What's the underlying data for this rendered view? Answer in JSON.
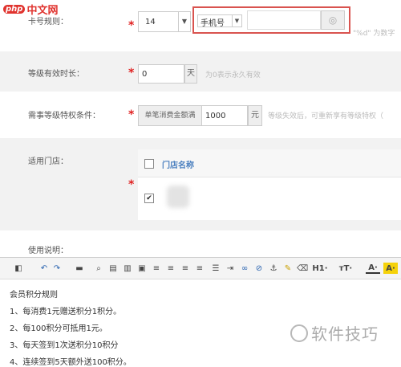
{
  "logo": {
    "text": "中文网",
    "badge": "php"
  },
  "rules": {
    "card_rule_label": "卡号规则：",
    "length_value": "14",
    "type_value": "手机号",
    "hint": "\"%d\" 为数字"
  },
  "validity": {
    "label": "等级有效时长：",
    "value": "0",
    "unit": "天",
    "hint": "为0表示永久有效"
  },
  "enjoy": {
    "label": "需事等级特权条件：",
    "prefix": "单笔消费金额满",
    "value": "1000",
    "unit": "元",
    "hint": "等级失效后，可重新享有等级特权（"
  },
  "stores": {
    "label": "适用门店：",
    "column_header": "门店名称"
  },
  "usage": {
    "label": "使用说明：",
    "toolbar": {
      "heading_btn": "H1·",
      "fontsize_btn": "тT·",
      "fontcolor_btn": "A·",
      "highlight_btn": "A·"
    },
    "content": [
      "会员积分规则",
      "1、每消费1元赠送积分1积分。",
      "2、每100积分可抵用1元。",
      "3、每天签到1次送积分10积分",
      "4、连续签到5天额外送100积分。"
    ]
  },
  "watermark": "软件技巧",
  "colors": {
    "highlight_border": "#d9534f",
    "required": "#e02020",
    "accent_blue": "#4a7fbf"
  }
}
